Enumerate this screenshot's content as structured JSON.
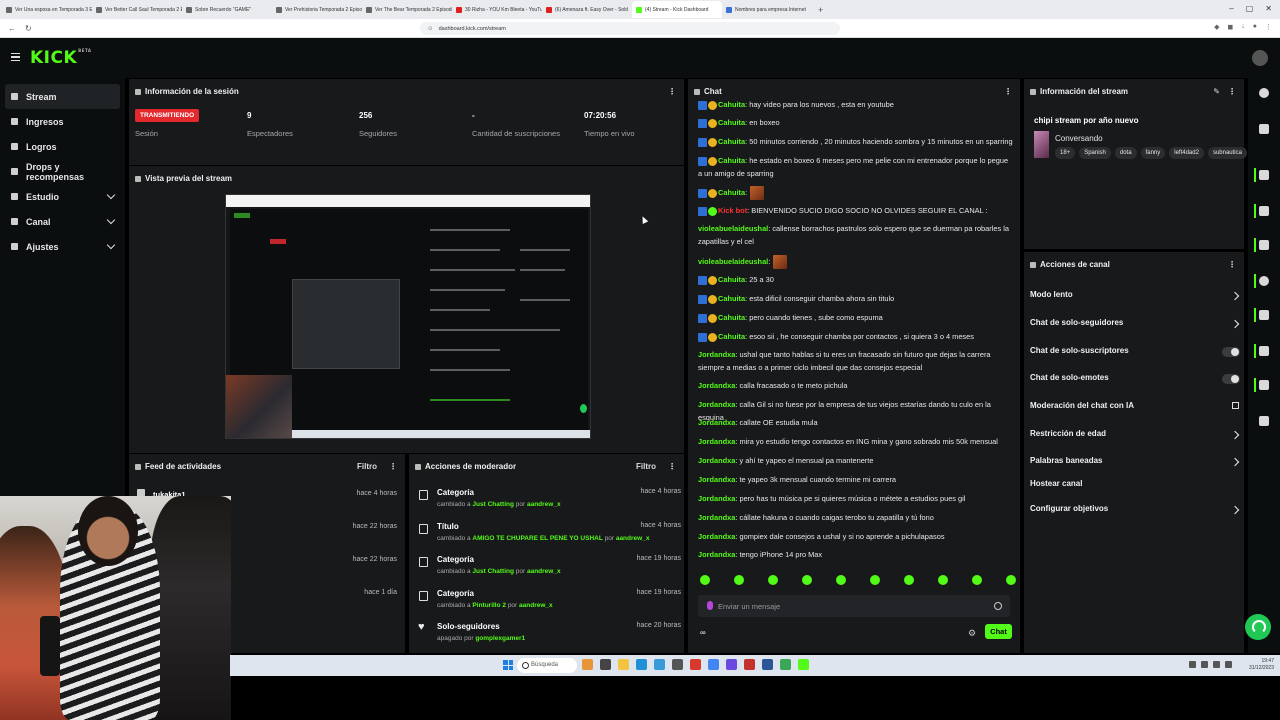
{
  "browser": {
    "tabs": [
      {
        "label": "Ver Una esposa en Temporada 3 Episodio",
        "fav": "gray"
      },
      {
        "label": "Ver Better Call Saul Temporada 2 Episodio",
        "fav": "gray"
      },
      {
        "label": "Sobre Recuerdo \"GAME\"",
        "fav": "gray"
      },
      {
        "label": "Ver Prehistoria Temporada 2 Episodio",
        "fav": "gray"
      },
      {
        "label": "Ver The Bear Temporada 2 Episodio",
        "fav": "gray"
      },
      {
        "label": "30 Rizha - YOU Km Bleeta - YouTube",
        "fav": "red"
      },
      {
        "label": "(6) Amenaza ft. Easy Over - Sold",
        "fav": "red"
      },
      {
        "label": "(4) Stream - Kick Dashboard",
        "fav": "green",
        "active": true
      },
      {
        "label": "Nombres para empresa Internet",
        "fav": "blue"
      }
    ],
    "url": "dashboard.kick.com/stream"
  },
  "sidebar": {
    "items": [
      {
        "label": "Stream",
        "icon": "broadcast-icon",
        "active": true
      },
      {
        "label": "Ingresos",
        "icon": "money-icon"
      },
      {
        "label": "Logros",
        "icon": "trophy-icon"
      },
      {
        "label": "Drops y recompensas",
        "icon": "gift-icon"
      },
      {
        "label": "Estudio",
        "icon": "studio-icon",
        "chevron": true
      },
      {
        "label": "Canal",
        "icon": "channel-icon",
        "chevron": true
      },
      {
        "label": "Ajustes",
        "icon": "settings-icon",
        "chevron": true
      }
    ]
  },
  "session": {
    "title": "Información de la sesión",
    "status_badge": "TRANSMITIENDO",
    "status_label": "Sesión",
    "viewers_value": "9",
    "viewers_label": "Espectadores",
    "followers_value": "256",
    "followers_label": "Seguidores",
    "subs_value": "-",
    "subs_label": "Cantidad de suscripciones",
    "time_value": "07:20:56",
    "time_label": "Tiempo en vivo"
  },
  "preview": {
    "title": "Vista previa del stream"
  },
  "feed": {
    "title": "Feed de actividades",
    "filter": "Filtro",
    "items": [
      {
        "name": "tukakita1",
        "time": "hace 4 horas"
      },
      {
        "name": "",
        "time": "hace 22 horas"
      },
      {
        "name": "",
        "time": "hace 22 horas"
      },
      {
        "name": "",
        "time": "hace 1 día"
      }
    ]
  },
  "mod": {
    "title": "Acciones de moderador",
    "filter": "Filtro",
    "items": [
      {
        "type": "Categoría",
        "pre": "cambiado a ",
        "value": "Just Chatting",
        "mid": " por ",
        "user": "aandrew_x",
        "time": "hace 4 horas",
        "icon": "category-icon"
      },
      {
        "type": "Título",
        "pre": "cambiado a ",
        "value": "AMIGO TE CHUPARE EL PENE YO USHAL",
        "mid": " por ",
        "user": "aandrew_x",
        "time": "hace 4 horas",
        "icon": "title-icon"
      },
      {
        "type": "Categoría",
        "pre": "cambiado a ",
        "value": "Just Chatting",
        "mid": " por ",
        "user": "aandrew_x",
        "time": "hace 19 horas",
        "icon": "category-icon"
      },
      {
        "type": "Categoría",
        "pre": "cambiado a ",
        "value": "Pinturillo 2",
        "mid": " por ",
        "user": "aandrew_x",
        "time": "hace 19 horas",
        "icon": "category-icon"
      },
      {
        "type": "Solo-seguidores",
        "pre": "apagado por ",
        "value": "",
        "mid": "",
        "user": "gomplexgamer1",
        "time": "hace 20 horas",
        "icon": "heart-icon"
      }
    ]
  },
  "chat": {
    "title": "Chat",
    "messages": [
      {
        "user": "Cahuita",
        "text": ": hay video para los nuevos , esta en youtube",
        "badges": "by"
      },
      {
        "user": "Cahuita",
        "text": ": en boxeo",
        "badges": "by"
      },
      {
        "user": "Cahuita",
        "text": ": 50 minutos corriendo , 20 minutos haciendo sombra y 15 minutos en un sparring",
        "badges": "by"
      },
      {
        "user": "Cahuita",
        "text": ": he estado en boxeo 6 meses pero me pelie con mi entrenador porque lo pegue a un amigo de sparring",
        "badges": "by"
      },
      {
        "user": "Cahuita",
        "text": ":",
        "badges": "by",
        "emote": true
      },
      {
        "user": "Kick bot",
        "text": ": BIENVENIDO SUCIO DIGO SOCIO NO OLVIDES SEGUIR EL CANAL :",
        "badges": "bg",
        "red": true
      },
      {
        "user": "violeabuelaideushal",
        "text": ": callense borrachos pastrulos solo espero que se duerman pa robarles la zapatillas y el cel",
        "badges": ""
      },
      {
        "user": "violeabuelaideushal",
        "text": ":",
        "badges": "",
        "emote": true
      },
      {
        "user": "Cahuita",
        "text": ": 25 a 30",
        "badges": "by"
      },
      {
        "user": "Cahuita",
        "text": ": esta dificil conseguir chamba ahora sin titulo",
        "badges": "by"
      },
      {
        "user": "Cahuita",
        "text": ": pero cuando tienes , sube como espuma",
        "badges": "by"
      },
      {
        "user": "Cahuita",
        "text": ": esoo sii , he conseguir chamba por contactos , si quiera 3 o 4 meses",
        "badges": "by"
      },
      {
        "user": "Jordandxa",
        "text": ": ushal que tanto hablas si tu eres un fracasado sin futuro que dejas la carrera siempre a medias o a primer ciclo imbecil que das consejos especial",
        "badges": ""
      },
      {
        "user": "Jordandxa",
        "text": ": calla fracasado o te meto pichula",
        "badges": ""
      },
      {
        "user": "Jordandxa",
        "text": ": calla Gil si no fuese por la empresa de tus viejos estarías dando tu culo en la esquina",
        "badges": ""
      },
      {
        "user": "Jordandxa",
        "text": ": callate OE estudia mula",
        "badges": ""
      },
      {
        "user": "Jordandxa",
        "text": ": mira yo estudio tengo contactos en ING mina y gano sobrado mis 50k mensual",
        "badges": ""
      },
      {
        "user": "Jordandxa",
        "text": ": y ahí te yapeo el mensual pa mantenerte",
        "badges": ""
      },
      {
        "user": "Jordandxa",
        "text": ": te yapeo 3k mensual cuando termine mi carrera",
        "badges": ""
      },
      {
        "user": "Jordandxa",
        "text": ": pero has tu música pe si quieres música o métete a estudios pues gil",
        "badges": ""
      },
      {
        "user": "Jordandxa",
        "text": ": cállate hakuna o cuando caigas terobo tu zapatilla y tú fono",
        "badges": ""
      },
      {
        "user": "Jordandxa",
        "text": ": gompiex dale consejos a ushal y si no aprende a pichulapasos",
        "badges": ""
      },
      {
        "user": "Jordandxa",
        "text": ": tengo iPhone 14 pro Max",
        "badges": ""
      }
    ],
    "input_placeholder": "Enviar un mensaje",
    "bottom_left": "∞",
    "send_label": "Chat"
  },
  "stream_info": {
    "title": "Información del stream",
    "stream_title": "chipi stream por año nuevo",
    "category": "Conversando",
    "tags": [
      "18+",
      "Spanish",
      "dota",
      "fanny",
      "left4dad2",
      "subnautica"
    ]
  },
  "channel_actions": {
    "title": "Acciones de canal",
    "items": [
      {
        "label": "Modo lento",
        "control": "arrow"
      },
      {
        "label": "Chat de solo-seguidores",
        "control": "arrow"
      },
      {
        "label": "Chat de solo-suscriptores",
        "control": "toggle"
      },
      {
        "label": "Chat de solo-emotes",
        "control": "toggle"
      },
      {
        "label": "Moderación del chat con IA",
        "control": "external"
      },
      {
        "label": "Restricción de edad",
        "control": "arrow"
      },
      {
        "label": "Palabras baneadas",
        "control": "arrow"
      },
      {
        "label": "Hostear canal",
        "control": "none"
      },
      {
        "label": "Configurar objetivos",
        "control": "arrow"
      }
    ]
  },
  "taskbar": {
    "search_label": "Búsqueda",
    "time": "19:47",
    "date": "31/12/2023"
  },
  "colors": {
    "accent": "#53fc18",
    "live": "#e3282e",
    "panel": "#18191b"
  }
}
